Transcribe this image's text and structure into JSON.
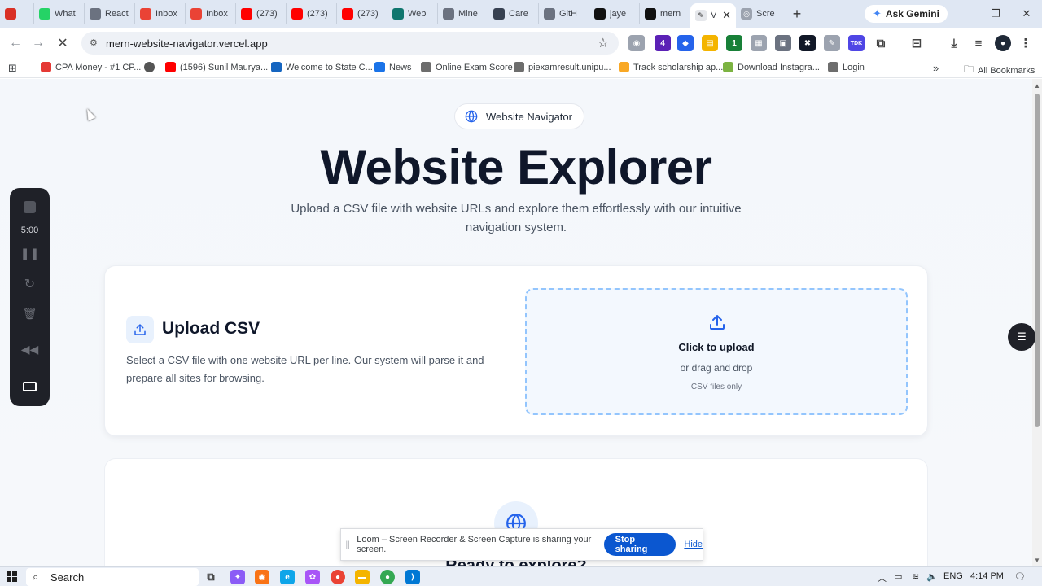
{
  "browser": {
    "tabs": [
      {
        "label": "",
        "icon": "record-icon",
        "color": "#d93025"
      },
      {
        "label": "What",
        "icon": "whatsapp-icon",
        "color": "#25d366"
      },
      {
        "label": "React",
        "icon": "globe-icon",
        "color": "#6b7280"
      },
      {
        "label": "Inbox",
        "icon": "gmail-icon",
        "color": "#ea4335"
      },
      {
        "label": "Inbox",
        "icon": "gmail-icon",
        "color": "#ea4335"
      },
      {
        "label": "(273)",
        "icon": "youtube-icon",
        "color": "#ff0000"
      },
      {
        "label": "(273)",
        "icon": "youtube-icon",
        "color": "#ff0000"
      },
      {
        "label": "(273)",
        "icon": "youtube-icon",
        "color": "#ff0000"
      },
      {
        "label": "Web",
        "icon": "web-icon",
        "color": "#0f766e"
      },
      {
        "label": "Mine",
        "icon": "globe-icon",
        "color": "#6b7280"
      },
      {
        "label": "Care",
        "icon": "career-icon",
        "color": "#374151"
      },
      {
        "label": "GitH",
        "icon": "globe-icon",
        "color": "#6b7280"
      },
      {
        "label": "jaye",
        "icon": "github-icon",
        "color": "#111111"
      },
      {
        "label": "mern",
        "icon": "vercel-icon",
        "color": "#111111"
      }
    ],
    "active_tab": {
      "label": "V",
      "close": "✕"
    },
    "after_tab": {
      "label": "Scre"
    },
    "new_tab": "+",
    "gemini": "Ask Gemini",
    "url": "mern-website-navigator.vercel.app",
    "extension_badges": {
      "a": "4",
      "b": "1"
    },
    "bookmarks": [
      {
        "label": "CPA Money - #1 CP...",
        "color": "#e53935"
      },
      {
        "label": "",
        "color": "#555555"
      },
      {
        "label": "(1596) Sunil Maurya...",
        "color": "#ff0000"
      },
      {
        "label": "Welcome to State C...",
        "color": "#1565c0"
      },
      {
        "label": "News",
        "color": "#1a73e8"
      },
      {
        "label": "Online Exam Score",
        "color": "#6d6d6d"
      },
      {
        "label": "piexamresult.unipu...",
        "color": "#6d6d6d"
      },
      {
        "label": "Track scholarship ap...",
        "color": "#f9a825"
      },
      {
        "label": "Download Instagra...",
        "color": "#7cb342"
      },
      {
        "label": "Login",
        "color": "#6d6d6d"
      }
    ],
    "more_bookmarks": "»",
    "all_bookmarks": "All Bookmarks"
  },
  "page": {
    "pill_label": "Website Navigator",
    "title": "Website Explorer",
    "subtitle": "Upload a CSV file with website URLs and explore them effortlessly with our intuitive navigation system.",
    "upload": {
      "title": "Upload CSV",
      "description": "Select a CSV file with one website URL per line. Our system will parse it and prepare all sites for browsing.",
      "dropzone_title": "Click to upload",
      "dropzone_sub": "or drag and drop",
      "dropzone_note": "CSV files only"
    },
    "next_card_title": "Ready to explore?"
  },
  "loom": {
    "timer": "5:00",
    "share_message": "Loom – Screen Recorder & Screen Capture is sharing your screen.",
    "stop_sharing": "Stop sharing",
    "hide": "Hide"
  },
  "taskbar": {
    "search": "Search",
    "language": "ENG",
    "time": "4:14 PM"
  },
  "colors": {
    "accent": "#0b57d0",
    "dropzone_border": "#93c5fd",
    "title": "#0f172a"
  }
}
